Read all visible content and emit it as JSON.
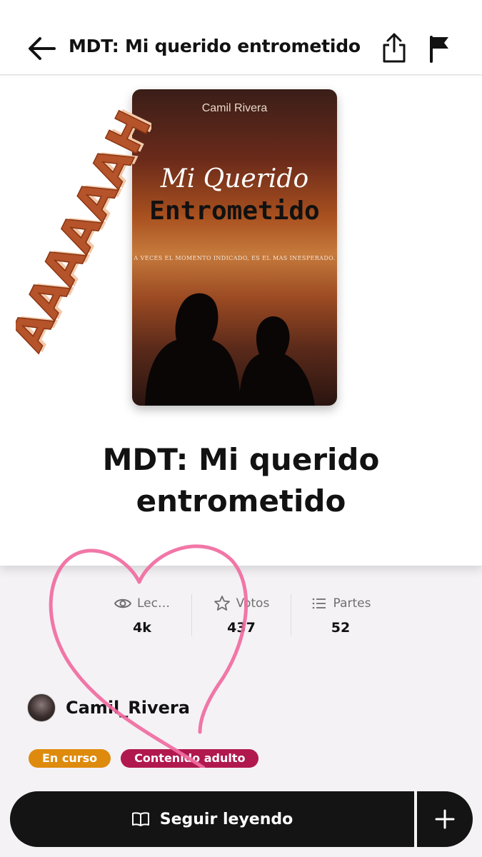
{
  "header": {
    "title": "MDT: Mi querido entrometido",
    "back_icon": "arrow-left-icon",
    "share_icon": "share-icon",
    "report_icon": "flag-icon"
  },
  "cover": {
    "author": "Camil Rivera",
    "title_line1": "Mi Querido",
    "title_line2": "Entrometido",
    "tagline": "A VECES EL MOMENTO INDICADO, ES EL MAS INESPERADO."
  },
  "sticker": {
    "text": "AAAAAAH"
  },
  "book": {
    "title_line1": "MDT: Mi querido",
    "title_line2": "entrometido"
  },
  "stats": [
    {
      "icon": "eye-icon",
      "label": "Lec…",
      "value": "4k"
    },
    {
      "icon": "star-icon",
      "label": "Votos",
      "value": "437"
    },
    {
      "icon": "list-icon",
      "label": "Partes",
      "value": "52"
    }
  ],
  "author": {
    "name": "Camil_Rivera"
  },
  "badges": {
    "status": "En curso",
    "rating": "Contenido adulto"
  },
  "actions": {
    "read_label": "Seguir leyendo",
    "add_icon": "plus-icon"
  },
  "colors": {
    "status_badge": "#de8a0d",
    "rating_badge": "#b0184e",
    "heart": "#f06ba0",
    "cta": "#141414"
  }
}
